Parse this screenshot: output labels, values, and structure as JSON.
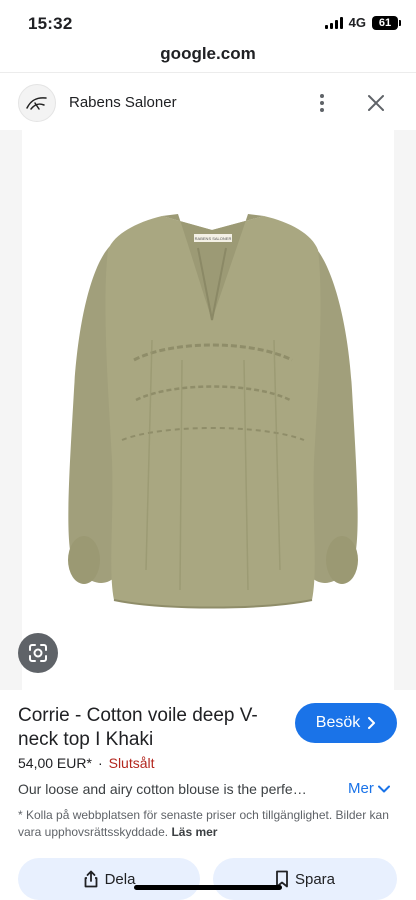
{
  "status_bar": {
    "time": "15:32",
    "network": "4G",
    "battery": "61"
  },
  "browser": {
    "url": "google.com"
  },
  "site": {
    "name": "Rabens Saloner"
  },
  "product": {
    "title": "Corrie - Cotton voile deep V-neck top I Khaki",
    "price": "54,00 EUR*",
    "separator": "·",
    "stock_status": "Slutsålt",
    "description": "Our loose and airy cotton blouse is the perfe…",
    "more_label": "Mer",
    "disclaimer": "* Kolla på webbplatsen för senaste priser och tillgänglighet. Bilder kan vara upphovsrättsskyddade.",
    "read_more_label": "Läs mer",
    "garment_label_text": "RABENS SALONER"
  },
  "actions": {
    "visit_label": "Besök",
    "share_label": "Dela",
    "save_label": "Spara"
  },
  "colors": {
    "accent": "#1a73e8",
    "sold_out": "#b3261e",
    "garment": "#a5a57f",
    "action_bg": "#e8f0fe"
  },
  "icons": [
    "site-logo-icon",
    "more-vert-icon",
    "close-icon",
    "lens-icon",
    "chevron-right-icon",
    "chevron-down-icon",
    "share-icon",
    "bookmark-icon"
  ]
}
